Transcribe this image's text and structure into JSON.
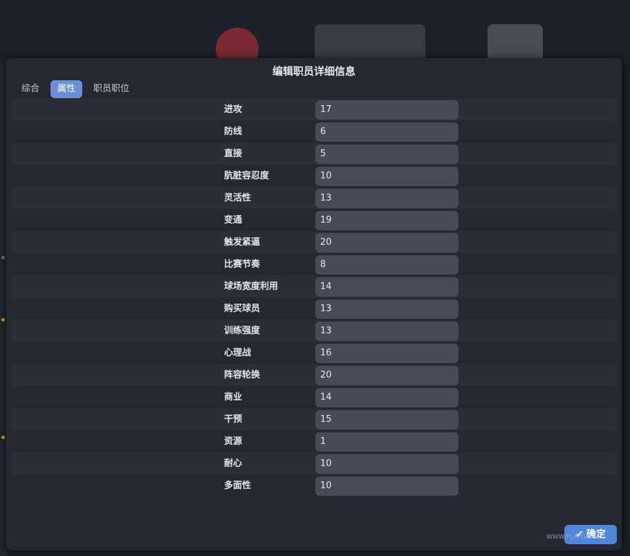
{
  "dialog": {
    "title": "编辑职员详细信息"
  },
  "tabs": [
    {
      "label": "综合",
      "active": false
    },
    {
      "label": "属性",
      "active": true
    },
    {
      "label": "职员职位",
      "active": false
    }
  ],
  "attributes": [
    {
      "label": "进攻",
      "value": "17"
    },
    {
      "label": "防线",
      "value": "6"
    },
    {
      "label": "直接",
      "value": "5"
    },
    {
      "label": "肮脏容忍度",
      "value": "10"
    },
    {
      "label": "灵活性",
      "value": "13"
    },
    {
      "label": "变通",
      "value": "19"
    },
    {
      "label": "触发紧逼",
      "value": "20"
    },
    {
      "label": "比赛节奏",
      "value": "8"
    },
    {
      "label": "球场宽度利用",
      "value": "14"
    },
    {
      "label": "购买球员",
      "value": "13"
    },
    {
      "label": "训练强度",
      "value": "13"
    },
    {
      "label": "心理战",
      "value": "16"
    },
    {
      "label": "阵容轮换",
      "value": "20"
    },
    {
      "label": "商业",
      "value": "14"
    },
    {
      "label": "干预",
      "value": "15"
    },
    {
      "label": "资源",
      "value": "1"
    },
    {
      "label": "耐心",
      "value": "10"
    },
    {
      "label": "多面性",
      "value": "10"
    }
  ],
  "footer": {
    "confirm_label": "确定",
    "watermark": "WWW.PLAYGM.CC"
  },
  "colors": {
    "accent": "#4f86d9",
    "tab_active": "#6a8fd4",
    "dialog_bg": "#262830",
    "input_bg": "#484b56"
  }
}
